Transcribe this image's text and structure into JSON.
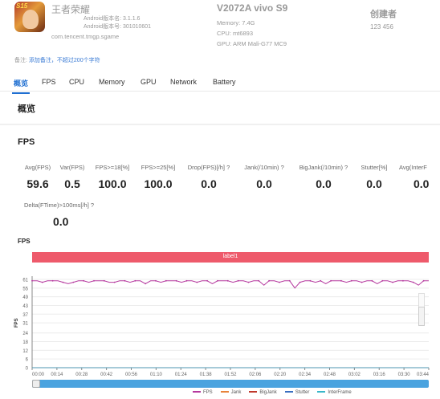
{
  "app": {
    "badge": "S15",
    "name": "王者荣耀",
    "version_label": "Android版本名: 3.1.1.6",
    "version_code": "Android版本号: 301010601",
    "package": "com.tencent.tmgp.sgame"
  },
  "device": {
    "name": "V2072A vivo S9",
    "memory": "Memory: 7.4G",
    "cpu": "CPU: mt6893",
    "gpu": "GPU: ARM Mali-G77 MC9"
  },
  "creator": {
    "label": "创建者",
    "value": "123 456"
  },
  "note": {
    "prefix": "备注:",
    "link": "添加备注，不超过200个字符"
  },
  "tabs": [
    "概览",
    "FPS",
    "CPU",
    "Memory",
    "GPU",
    "Network",
    "Battery"
  ],
  "section_title": "概览",
  "fps_section_title": "FPS",
  "metrics": [
    {
      "label": "Avg(FPS)",
      "value": "59.6"
    },
    {
      "label": "Var(FPS)",
      "value": "0.5"
    },
    {
      "label": "FPS>=18[%]",
      "value": "100.0"
    },
    {
      "label": "FPS>=25[%]",
      "value": "100.0"
    },
    {
      "label": "Drop(FPS)[/h] ?",
      "value": "0.0"
    },
    {
      "label": "Jank(/10min) ?",
      "value": "0.0"
    },
    {
      "label": "BigJank(/10min) ?",
      "value": "0.0"
    },
    {
      "label": "Stutter[%]",
      "value": "0.0"
    },
    {
      "label": "Avg(InterF",
      "value": "0.0"
    },
    {
      "label": "Delta(FTime)>100ms[/h] ?",
      "value": "0.0"
    }
  ],
  "chart_data": {
    "type": "line",
    "title": "FPS",
    "label_band": "label1",
    "ylabel": "FPS",
    "ylim": [
      0,
      61
    ],
    "yticks": [
      "61",
      "55",
      "49",
      "43",
      "37",
      "31",
      "24",
      "18",
      "12",
      "6",
      "0"
    ],
    "xticks": [
      "00:00",
      "00:14",
      "00:28",
      "00:42",
      "00:56",
      "01:10",
      "01:24",
      "01:38",
      "01:52",
      "02:06",
      "02:20",
      "02:34",
      "02:48",
      "03:02",
      "03:16",
      "03:30",
      "03:44"
    ],
    "series": [
      {
        "name": "FPS",
        "color": "#b5389e",
        "values": [
          60,
          60,
          59,
          60,
          60,
          60,
          59,
          58,
          59,
          60,
          60,
          59,
          60,
          60,
          60,
          59,
          59,
          60,
          60,
          59,
          60,
          60,
          58,
          60,
          60,
          59,
          60,
          60,
          60,
          59,
          60,
          60,
          59,
          60,
          60,
          58,
          60,
          60,
          60,
          59,
          60,
          60,
          59,
          60,
          60,
          57,
          60,
          60,
          59,
          60,
          60,
          55,
          59,
          60,
          60,
          59,
          60,
          58,
          60,
          60,
          60,
          59,
          60,
          60,
          59,
          60,
          60,
          58,
          60,
          60,
          59,
          60,
          60,
          60,
          59,
          57,
          60,
          60
        ]
      },
      {
        "name": "Jank",
        "color": "#e8833a",
        "values": [
          0
        ]
      },
      {
        "name": "BigJank",
        "color": "#c0392b",
        "values": [
          0
        ]
      },
      {
        "name": "Stutter",
        "color": "#3a6fc0",
        "values": [
          0
        ]
      },
      {
        "name": "InterFrame",
        "color": "#39b7c9",
        "values": [
          0
        ]
      }
    ],
    "grid": true,
    "legend": "bottom"
  }
}
